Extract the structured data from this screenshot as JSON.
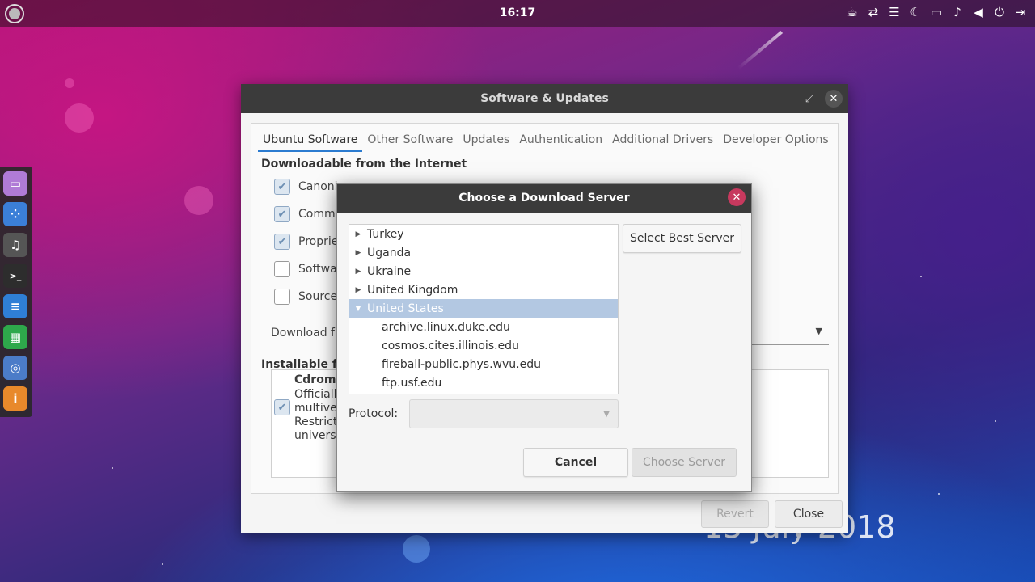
{
  "top_panel": {
    "clock": "16:17",
    "tray_icons": [
      "coffee-icon",
      "network-arrows-icon",
      "menu-lines-icon",
      "moon-icon",
      "folder-icon",
      "bell-icon",
      "volume-icon",
      "power-icon",
      "logout-icon"
    ]
  },
  "dock": {
    "items": [
      {
        "name": "files",
        "glyph": "▭",
        "color": "#b07bd6"
      },
      {
        "name": "apps",
        "glyph": "⁘",
        "color": "#3b7fd8"
      },
      {
        "name": "music",
        "glyph": "♫",
        "color": "#555555"
      },
      {
        "name": "terminal",
        "glyph": ">_",
        "color": "#2d2d2d"
      },
      {
        "name": "writer",
        "glyph": "≡",
        "color": "#2f7fd6"
      },
      {
        "name": "calc",
        "glyph": "▦",
        "color": "#2ea84b"
      },
      {
        "name": "browser",
        "glyph": "◎",
        "color": "#4b7cc8"
      },
      {
        "name": "info",
        "glyph": "i",
        "color": "#e8892b"
      }
    ]
  },
  "background": {
    "date_text": "13 July 2018"
  },
  "main_window": {
    "title": "Software & Updates",
    "tabs": [
      "Ubuntu Software",
      "Other Software",
      "Updates",
      "Authentication",
      "Additional Drivers",
      "Developer Options"
    ],
    "section_download": "Downloadable from the Internet",
    "checkboxes": [
      {
        "label": "Canoni",
        "checked": true
      },
      {
        "label": "Commu",
        "checked": true
      },
      {
        "label": "Proprie",
        "checked": true
      },
      {
        "label": "Softwa",
        "checked": false
      },
      {
        "label": "Source",
        "checked": false
      }
    ],
    "download_from_label": "Download fr",
    "section_installable": "Installable fr",
    "cdrom": {
      "title": "Cdrom",
      "lines": [
        "Officiall",
        "multiver",
        "Restrict",
        "universe"
      ],
      "checked": true
    },
    "revert_label": "Revert",
    "close_label": "Close"
  },
  "dialog": {
    "title": "Choose a Download Server",
    "countries": [
      {
        "label": "Turkey",
        "expanded": false,
        "selected": false
      },
      {
        "label": "Uganda",
        "expanded": false,
        "selected": false
      },
      {
        "label": "Ukraine",
        "expanded": false,
        "selected": false
      },
      {
        "label": "United Kingdom",
        "expanded": false,
        "selected": false
      },
      {
        "label": "United States",
        "expanded": true,
        "selected": true
      }
    ],
    "servers": [
      "archive.linux.duke.edu",
      "cosmos.cites.illinois.edu",
      "fireball-public.phys.wvu.edu",
      "ftp.usf.edu"
    ],
    "select_best_label": "Select Best Server",
    "protocol_label": "Protocol:",
    "protocol_value": "",
    "cancel_label": "Cancel",
    "choose_label": "Choose Server"
  }
}
